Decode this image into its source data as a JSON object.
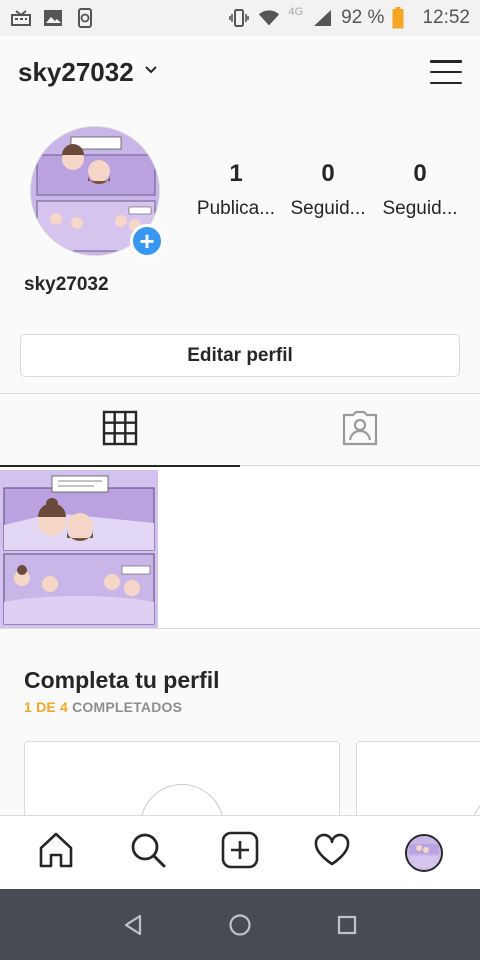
{
  "status_bar": {
    "battery_percent": "92 %",
    "time": "12:52",
    "network": "4G"
  },
  "header": {
    "username": "sky27032"
  },
  "profile": {
    "display_name": "sky27032",
    "stats": [
      {
        "value": "1",
        "label": "Publica..."
      },
      {
        "value": "0",
        "label": "Seguid..."
      },
      {
        "value": "0",
        "label": "Seguid..."
      }
    ],
    "edit_button_label": "Editar perfil",
    "add_badge": "+"
  },
  "complete_profile": {
    "title": "Completa tu perfil",
    "progress": "1 DE 4",
    "progress_suffix": "COMPLETADOS"
  },
  "colors": {
    "accent_blue": "#3897f0",
    "progress_orange": "#f5a623",
    "thumbnail_purple": "#c7b3e6"
  },
  "icons": {
    "grid_tab": "grid-icon",
    "tagged_tab": "tagged-person-icon",
    "nav": [
      "home-icon",
      "search-icon",
      "add-post-icon",
      "heart-icon",
      "profile-avatar"
    ]
  }
}
